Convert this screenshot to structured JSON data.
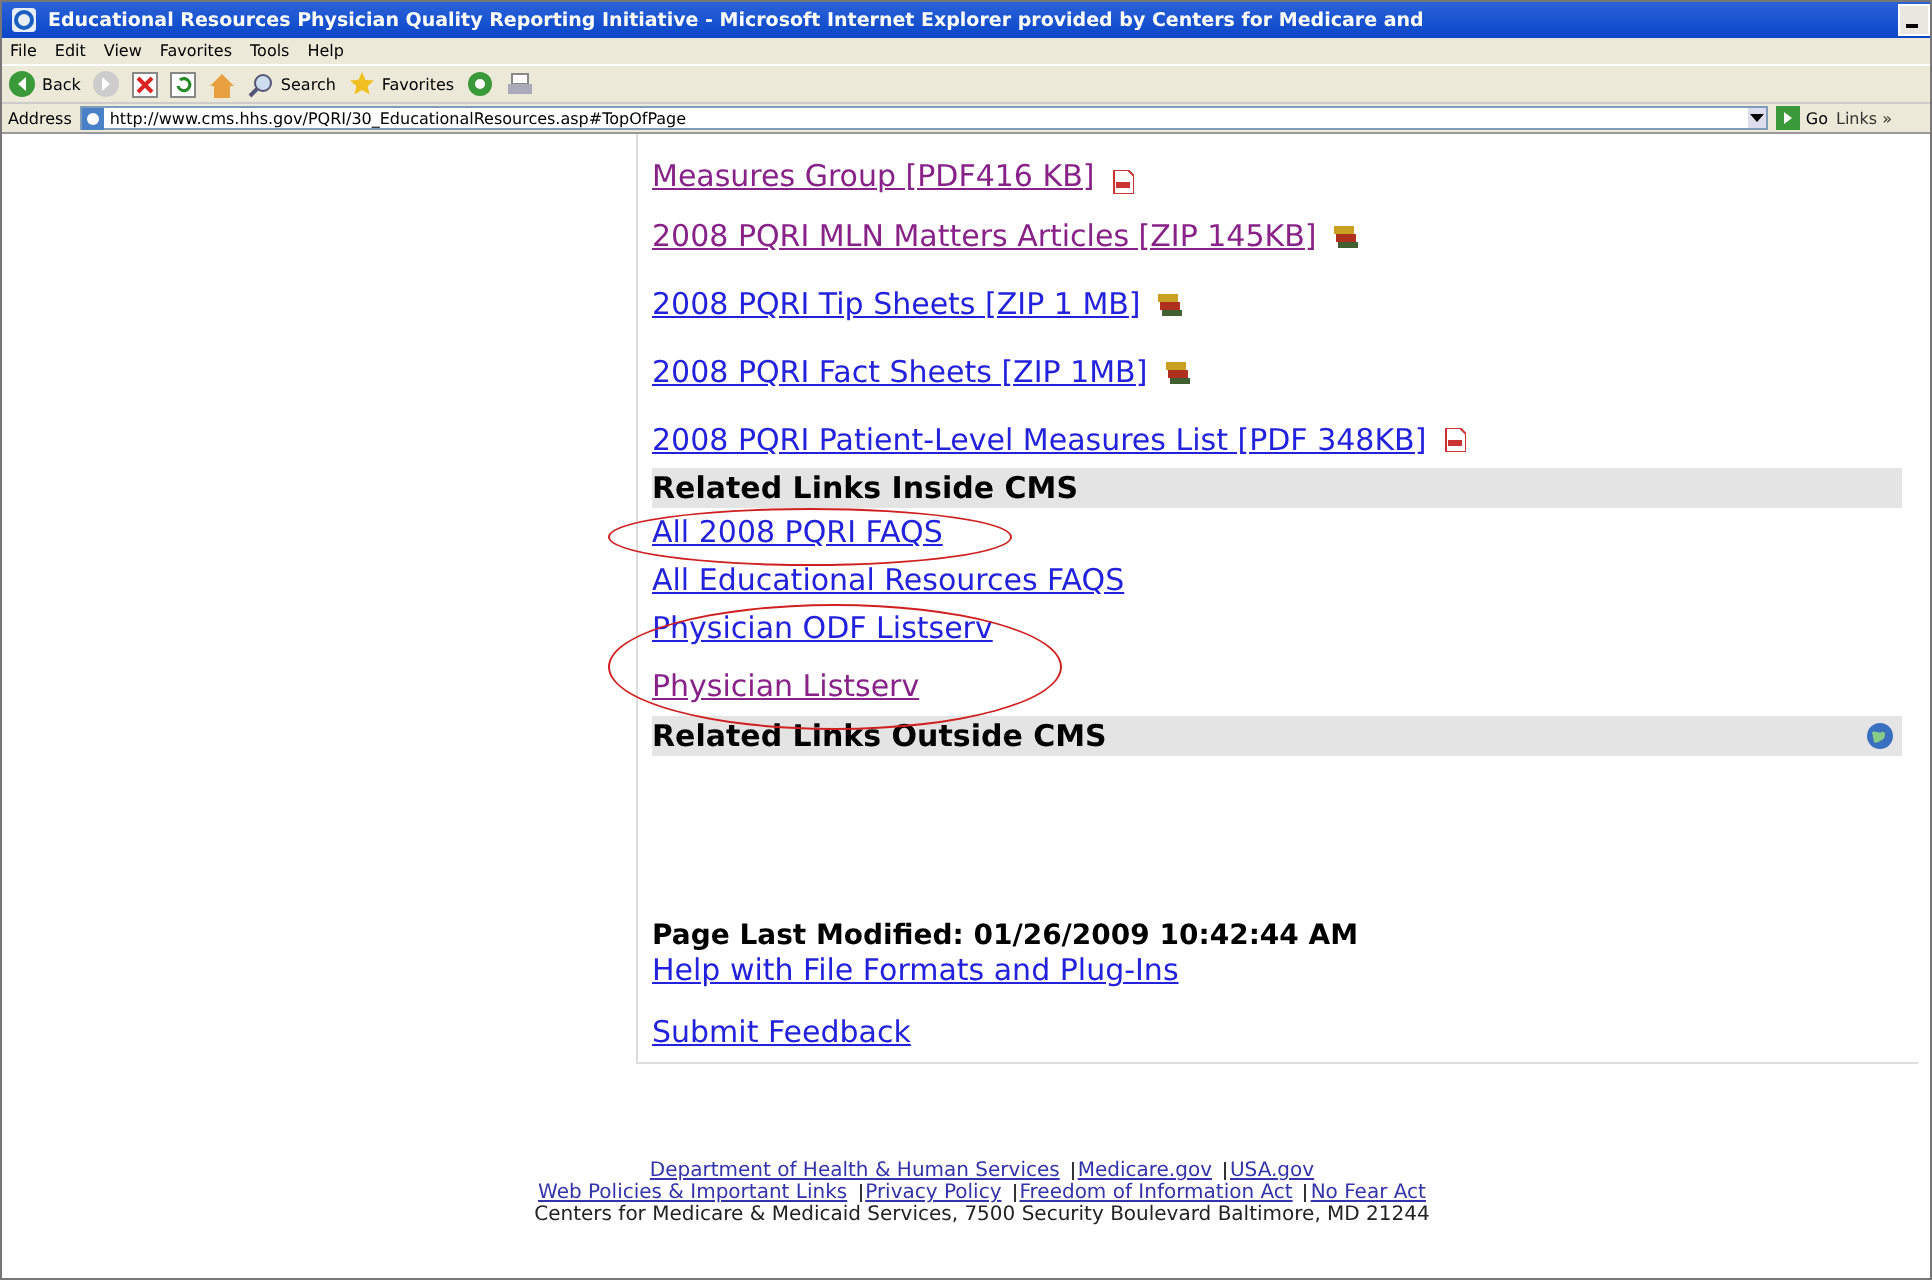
{
  "window": {
    "title": "Educational Resources Physician Quality Reporting Initiative - Microsoft Internet Explorer provided by Centers for Medicare and"
  },
  "menu": [
    "File",
    "Edit",
    "View",
    "Favorites",
    "Tools",
    "Help"
  ],
  "toolbar": {
    "back": "Back",
    "search": "Search",
    "favorites": "Favorites"
  },
  "address": {
    "label": "Address",
    "url": "http://www.cms.hhs.gov/PQRI/30_EducationalResources.asp#TopOfPage",
    "go": "Go",
    "links": "Links »"
  },
  "downloads": [
    {
      "text": "Measures Group [PDF416 KB]",
      "visited": true,
      "kind": "pdf"
    },
    {
      "text": "2008 PQRI MLN Matters Articles [ZIP 145KB]",
      "visited": true,
      "kind": "zip"
    },
    {
      "text": "2008 PQRI Tip Sheets [ZIP 1 MB]",
      "visited": false,
      "kind": "zip"
    },
    {
      "text": "2008 PQRI Fact Sheets [ZIP 1MB]",
      "visited": false,
      "kind": "zip"
    },
    {
      "text": "2008 PQRI Patient-Level Measures List [PDF 348KB]",
      "visited": false,
      "kind": "pdf"
    }
  ],
  "inside": {
    "heading": "Related Links Inside CMS",
    "links": [
      {
        "text": "All 2008 PQRI FAQS",
        "visited": false,
        "circled": true
      },
      {
        "text": "All Educational Resources FAQS",
        "visited": false,
        "circled": false
      },
      {
        "text": "Physician ODF Listserv",
        "visited": false,
        "circled": true
      },
      {
        "text": "Physician Listserv",
        "visited": true,
        "circled": true
      }
    ]
  },
  "outside": {
    "heading": "Related Links Outside CMS"
  },
  "last_modified": "Page Last Modified: 01/26/2009 10:42:44 AM",
  "help_link": "Help with File Formats and Plug-Ins",
  "feedback_link": "Submit Feedback",
  "footer": [
    [
      "Department of Health & Human Services",
      "Medicare.gov",
      "USA.gov"
    ],
    [
      "Web Policies & Important Links",
      "Privacy Policy",
      "Freedom of Information Act",
      "No Fear Act"
    ]
  ],
  "footer_address": "Centers for Medicare & Medicaid Services, 7500 Security Boulevard Baltimore, MD 21244"
}
